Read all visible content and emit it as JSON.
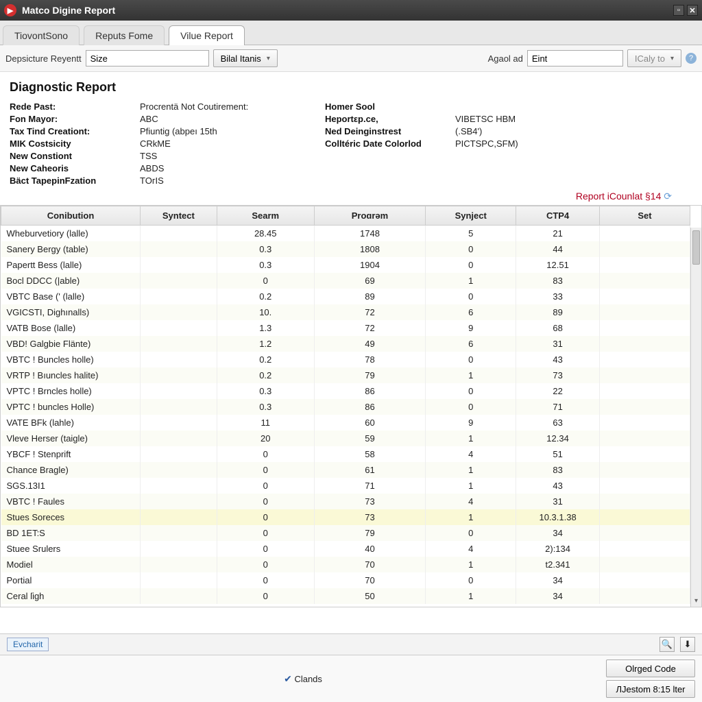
{
  "window": {
    "title": "Matco Digine Report",
    "minimize": "▫",
    "close": "✕"
  },
  "tabs": [
    {
      "label": "TiovontSono"
    },
    {
      "label": "Reputs Fome"
    },
    {
      "label": "Vilue Report",
      "active": true
    }
  ],
  "toolbar": {
    "filter_label": "Depsicture Reyentt",
    "filter_value": "Size",
    "bial_btn": "Bilal Itanis",
    "agol_label": "Agaol ad",
    "agol_value": "Eint",
    "caly_btn": "ICaly to"
  },
  "report": {
    "title": "Diagnostic Report",
    "left": [
      {
        "label": "Rede Past:",
        "value": "Procrentä Not Coutirement:"
      },
      {
        "label": "Fon Mayor:",
        "value": "ABC"
      },
      {
        "label": "Tax Tind Creationt:",
        "value": "Pfiuntig (abpeı 15th"
      },
      {
        "label": "MIK Costsicity",
        "value": "CRkME"
      },
      {
        "label": "New Constiont",
        "value": "TSS"
      },
      {
        "label": "New Caheoris",
        "value": "ABDS"
      },
      {
        "label": "Bäct TapepinFzation",
        "value": "TOгIS"
      }
    ],
    "right": [
      {
        "label": "Homer Sool",
        "value": ""
      },
      {
        "label": "Heportεp.ce,",
        "value": "VIBETSC HBM"
      },
      {
        "label": "Ned Deinginstrest",
        "value": "(.SB4')"
      },
      {
        "label": "Colltéric Date Colorlod",
        "value": "PICTSPC,SFM)"
      }
    ],
    "count_label": "Report iCounlat §14"
  },
  "grid": {
    "headers": [
      "Conibution",
      "Syntect",
      "Searm",
      "Proɑrəm",
      "Synject",
      "CTP4",
      "Set"
    ],
    "rows": [
      {
        "c": [
          "Whеburvetiory (lalle)",
          "",
          "28.45",
          "1748",
          "5",
          "21",
          ""
        ]
      },
      {
        "c": [
          "Sanery Bergy (table)",
          "",
          "0.3",
          "1808",
          "0",
          "44",
          ""
        ]
      },
      {
        "c": [
          "Papertt Bess (lalle)",
          "",
          "0.3",
          "1904",
          "0",
          "12.51",
          ""
        ]
      },
      {
        "c": [
          "Bocl DDCC (|able)",
          "",
          "0",
          "69",
          "1",
          "83",
          ""
        ]
      },
      {
        "c": [
          "VBTC  Base (' (lalle)",
          "",
          "0.2",
          "89",
          "0",
          "33",
          ""
        ]
      },
      {
        "c": [
          "VGICSTI, Dighınalls)",
          "",
          "10.",
          "72",
          "6",
          "89",
          ""
        ]
      },
      {
        "c": [
          "VATB  Bose (lalle)",
          "",
          "1.3",
          "72",
          "9",
          "68",
          ""
        ]
      },
      {
        "c": [
          "VBD! Galgbie Flänte)",
          "",
          "1.2",
          "49",
          "6",
          "31",
          ""
        ]
      },
      {
        "c": [
          "VBTC ! Buncles holle)",
          "",
          "0.2",
          "78",
          "0",
          "43",
          ""
        ]
      },
      {
        "c": [
          "VRTP ! Bıuncles halite)",
          "",
          "0.2",
          "79",
          "1",
          "73",
          ""
        ]
      },
      {
        "c": [
          "VPTC ! Brncles holle)",
          "",
          "0.3",
          "86",
          "0",
          "22",
          ""
        ]
      },
      {
        "c": [
          "VPTC ! buncles Holle)",
          "",
          "0.3",
          "86",
          "0",
          "71",
          ""
        ]
      },
      {
        "c": [
          "VATE  BFk (lahle)",
          "",
          "11",
          "60",
          "9",
          "63",
          ""
        ]
      },
      {
        "c": [
          "Vleve Herser (taigle)",
          "",
          "20",
          "59",
          "1",
          "12.34",
          ""
        ]
      },
      {
        "c": [
          "YBCF ! Stenprift",
          "",
          "0",
          "58",
          "4",
          "51",
          ""
        ]
      },
      {
        "c": [
          "Chance Bragle)",
          "",
          "0",
          "61",
          "1",
          "83",
          ""
        ]
      },
      {
        "c": [
          "SGS.13I1",
          "",
          "0",
          "71",
          "1",
          "43",
          ""
        ]
      },
      {
        "c": [
          "VBTC ! Faules",
          "",
          "0",
          "73",
          "4",
          "31",
          ""
        ]
      },
      {
        "c": [
          "Stues Soreces",
          "",
          "0",
          "73",
          "1",
          "10.3.1.38",
          ""
        ],
        "sel": true
      },
      {
        "c": [
          "BD 1ET:S",
          "",
          "0",
          "79",
          "0",
          "34",
          ""
        ]
      },
      {
        "c": [
          "Stuee Srulers",
          "",
          "0",
          "40",
          "4",
          "2):134",
          ""
        ]
      },
      {
        "c": [
          "Modiel",
          "",
          "0",
          "70",
          "1",
          "t2.341",
          ""
        ]
      },
      {
        "c": [
          "Portial",
          "",
          "0",
          "70",
          "0",
          "34",
          ""
        ]
      },
      {
        "c": [
          "Ceral ſigh",
          "",
          "0",
          "50",
          "1",
          "34",
          ""
        ]
      }
    ]
  },
  "footer": {
    "export": "Evcharit",
    "clands": "Clands",
    "orged": "Olrged Code",
    "destom": "ЛJestom 8:15 lter"
  }
}
